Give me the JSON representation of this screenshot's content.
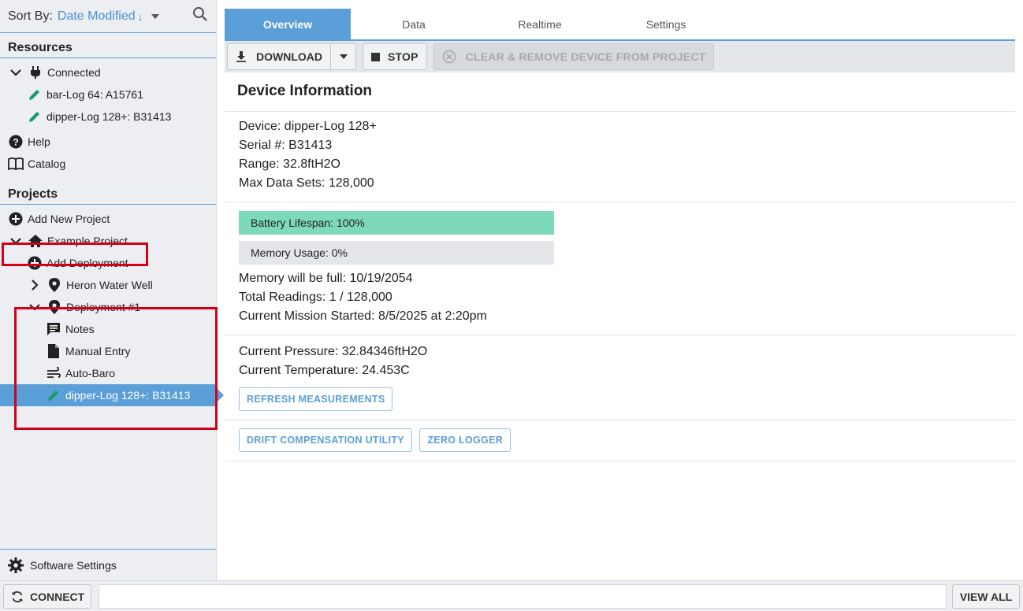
{
  "sidebar": {
    "sort": {
      "label": "Sort By:",
      "value": "Date Modified",
      "direction_glyph": "↓"
    },
    "resources_title": "Resources",
    "connected_label": "Connected",
    "devices": [
      "bar-Log 64: A15761",
      "dipper-Log 128+: B31413"
    ],
    "help_label": "Help",
    "catalog_label": "Catalog",
    "projects_title": "Projects",
    "add_project_label": "Add New Project",
    "project_name": "Example Project",
    "add_deployment_label": "Add Deployment",
    "deployment_1": "Heron Water Well",
    "deployment_2": "Deployment #1",
    "notes_label": "Notes",
    "manual_entry_label": "Manual Entry",
    "auto_baro_label": "Auto-Baro",
    "selected_device": "dipper-Log 128+: B31413",
    "settings_label": "Software Settings"
  },
  "tabs": [
    "Overview",
    "Data",
    "Realtime",
    "Settings"
  ],
  "toolbar": {
    "download_label": "DOWNLOAD",
    "stop_label": "STOP",
    "clear_label": "CLEAR & REMOVE DEVICE FROM PROJECT"
  },
  "device_info": {
    "title": "Device Information",
    "device": "Device: dipper-Log 128+",
    "serial": "Serial #: B31413",
    "range": "Range: 32.8ftH2O",
    "max_sets": "Max Data Sets: 128,000",
    "battery_label": "Battery Lifespan: 100%",
    "battery_level": 1.0,
    "memory_label": "Memory Usage: 0%",
    "memory_level": 0.0,
    "memory_full": "Memory will be full: 10/19/2054",
    "total_readings": "Total Readings: 1 / 128,000",
    "mission_started": "Current Mission Started: 8/5/2025 at 2:20pm",
    "pressure": "Current Pressure: 32.84346ftH2O",
    "temperature": "Current Temperature: 24.453C",
    "refresh_label": "REFRESH MEASUREMENTS",
    "drift_label": "DRIFT COMPENSATION UTILITY",
    "zero_label": "ZERO LOGGER"
  },
  "bottombar": {
    "connect_label": "CONNECT",
    "input_value": "",
    "view_all_label": "VIEW ALL"
  },
  "colors": {
    "accent": "#5b9fd8",
    "battery": "#7dd9b9",
    "pencil": "#1a9a6a",
    "highlight_box": "#d0021b"
  }
}
